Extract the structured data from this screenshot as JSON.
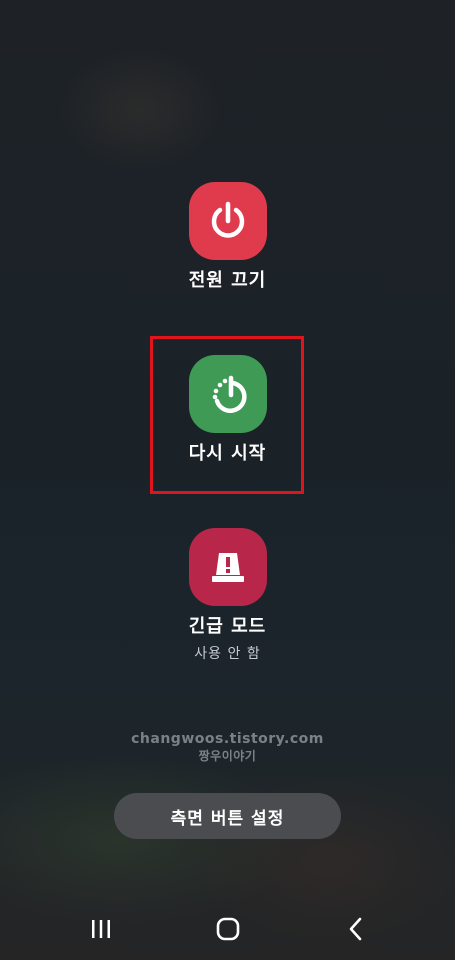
{
  "power_off": {
    "label": "전원 끄기",
    "icon": "power-icon",
    "color": "#e03b4c"
  },
  "restart": {
    "label": "다시 시작",
    "icon": "restart-icon",
    "color": "#3e9a55"
  },
  "emergency": {
    "label": "긴급 모드",
    "sublabel": "사용 안 함",
    "icon": "emergency-light-icon",
    "color": "#b8264a"
  },
  "watermark": {
    "line1": "changwoos.tistory.com",
    "line2": "짱우이야기"
  },
  "side_button": {
    "label": "측면 버튼 설정"
  },
  "navbar": {
    "recents_icon": "recents-icon",
    "home_icon": "home-icon",
    "back_icon": "back-icon"
  },
  "highlight_color": "#e0141c"
}
